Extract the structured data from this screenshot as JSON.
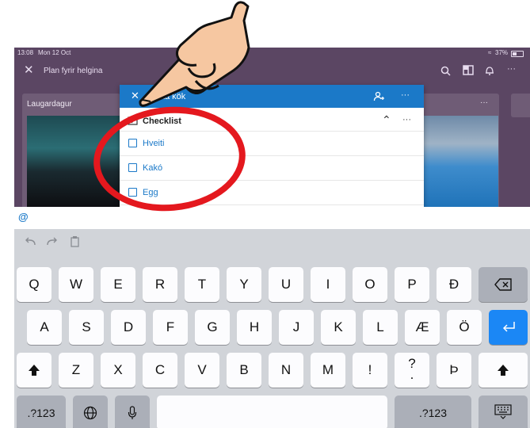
{
  "status_bar": {
    "time": "13:08",
    "date": "Mon 12 Oct",
    "battery": "37%"
  },
  "app_bar": {
    "title": "Plan fyrir helgina"
  },
  "background": {
    "card_left_title": "Laugardagur",
    "card_left_menu": "···",
    "card_right_menu": "···"
  },
  "task": {
    "title": "Baka kök",
    "section_title": "Checklist",
    "more": "···",
    "items": [
      {
        "label": "Hveiti"
      },
      {
        "label": "Kakó"
      },
      {
        "label": "Egg"
      }
    ]
  },
  "mention_bar": {
    "symbol": "@"
  },
  "keyboard": {
    "row1": [
      "Q",
      "W",
      "E",
      "R",
      "T",
      "Y",
      "U",
      "I",
      "O",
      "P",
      "Ð"
    ],
    "row2": [
      "A",
      "S",
      "D",
      "F",
      "G",
      "H",
      "J",
      "K",
      "L",
      "Æ",
      "Ö"
    ],
    "row3": [
      "Z",
      "X",
      "C",
      "V",
      "B",
      "N",
      "M",
      "!",
      "Þ"
    ],
    "row3_special": {
      "top": "?",
      "bottom": "."
    },
    "numbers_label": ".?123"
  },
  "colors": {
    "accent": "#1b79c8",
    "app_background": "#5b4663",
    "annotation_ring": "#e4181e",
    "return_key": "#1b87f5"
  }
}
